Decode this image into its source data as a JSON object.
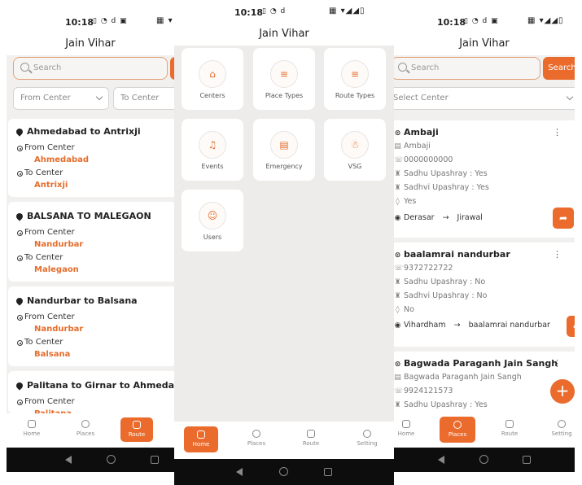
{
  "colors": {
    "accent": "#ea6b2c",
    "accent_text": "#e46d2c"
  },
  "status_time": "10:18",
  "app_title": "Jain Vihar",
  "screen1": {
    "search_placeholder": "Search",
    "from_center_placeholder": "From Center",
    "to_center_placeholder": "To Center",
    "from_label": "From Center",
    "to_label": "To Center",
    "routes": [
      {
        "title": "Ahmedabad to Antrixji",
        "from": "Ahmedabad",
        "to": "Antrixji"
      },
      {
        "title": "BALSANA TO MALEGAON",
        "from": "Nandurbar",
        "to": "Malegaon"
      },
      {
        "title": "Nandurbar to Balsana",
        "from": "Nandurbar",
        "to": "Balsana"
      },
      {
        "title": "Palitana to Girnar to Ahmedabad",
        "from": "Palitana",
        "to": ""
      }
    ],
    "nav": [
      "Home",
      "Places",
      "Route"
    ]
  },
  "screen2": {
    "tiles": [
      {
        "label": "Centers",
        "icon": "temple-icon"
      },
      {
        "label": "Place Types",
        "icon": "list-icon"
      },
      {
        "label": "Route Types",
        "icon": "list-icon"
      },
      {
        "label": "Events",
        "icon": "bell-icon"
      },
      {
        "label": "Emergency",
        "icon": "id-card-icon"
      },
      {
        "label": "VSG",
        "icon": "person-icon"
      },
      {
        "label": "Users",
        "icon": "user-icon"
      }
    ],
    "nav": [
      "Home",
      "Places",
      "Route",
      "Setting"
    ]
  },
  "screen3": {
    "search_placeholder": "Search",
    "search_button": "Search",
    "select_center_placeholder": "Select Center",
    "centers": [
      {
        "name": "Ambaji",
        "subtitle": "Ambaji",
        "phone": "0000000000",
        "sadhu": "Sadhu Upashray : Yes",
        "sadhvi": "Sadhvi Upashray : Yes",
        "water": "Yes",
        "route_from": "Derasar",
        "route_to": "Jirawal"
      },
      {
        "name": "baalamrai nandurbar",
        "phone": "9372722722",
        "sadhu": "Sadhu Upashray : No",
        "sadhvi": "Sadhvi Upashray : No",
        "water": "No",
        "route_from": "Vihardham",
        "route_to": "baalamrai nandurbar"
      },
      {
        "name": "Bagwada Paraganh Jain Sangh",
        "subtitle": "Bagwada Paraganh Jain Sangh",
        "phone": "9924121573",
        "sadhu": "Sadhu Upashray : Yes"
      }
    ],
    "nav": [
      "Home",
      "Places",
      "Route",
      "Setting"
    ]
  }
}
